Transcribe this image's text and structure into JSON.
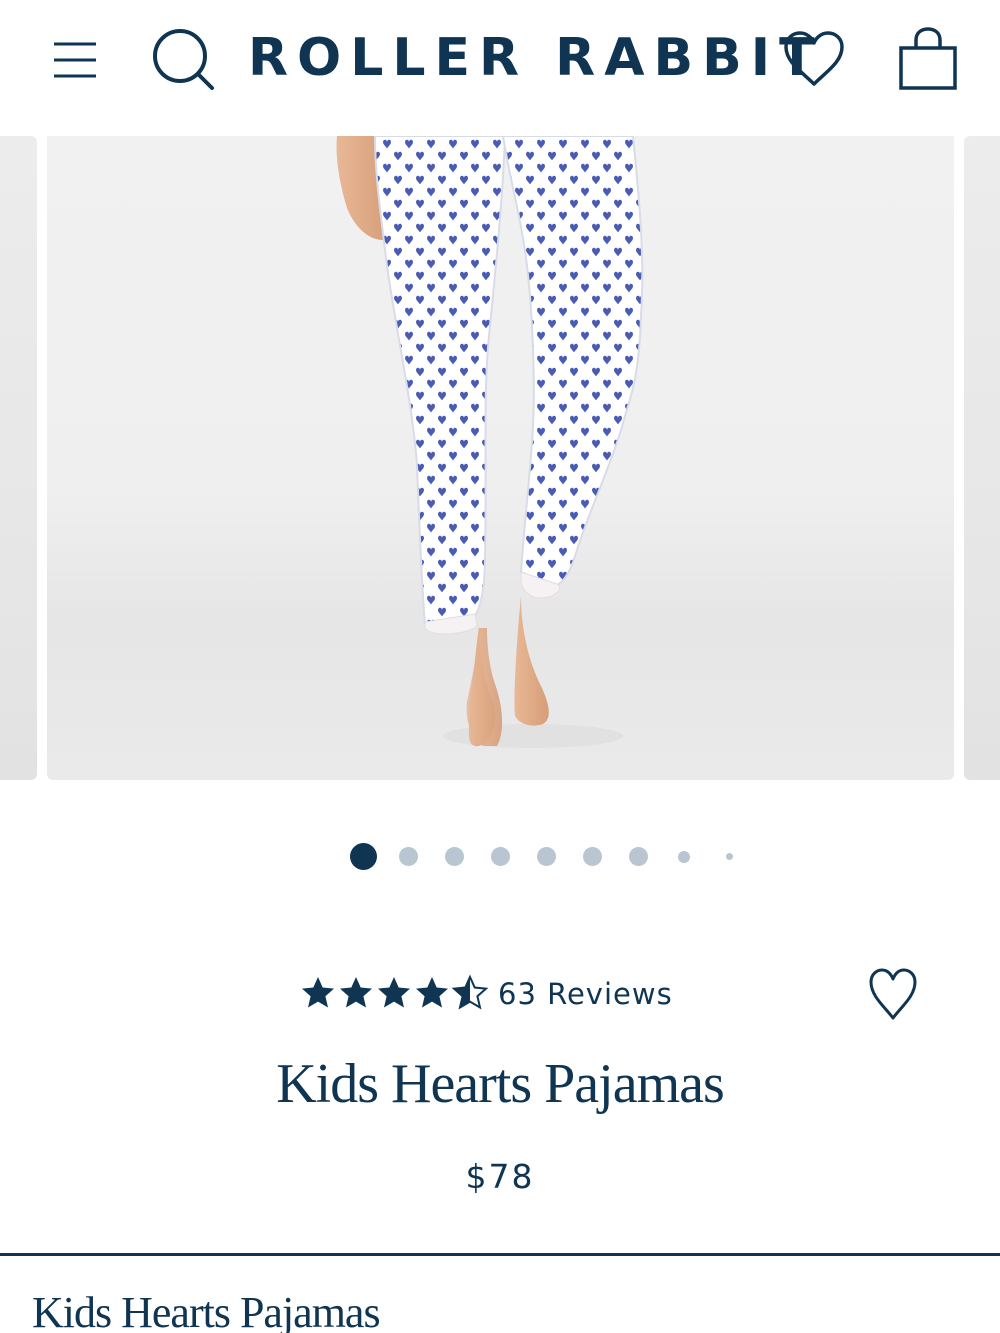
{
  "header": {
    "logo_text": "ROLLER RABBIT",
    "icons": [
      "menu-icon",
      "search-icon",
      "heart-icon",
      "shopping-bag-icon"
    ]
  },
  "carousel": {
    "current_slide": 1,
    "total_slides": 9,
    "image_subject": "hearts-print-pajama-pants"
  },
  "product": {
    "rating": 4.5,
    "rating_max": 5,
    "reviews_label": "63 Reviews",
    "title": "Kids Hearts Pajamas",
    "price": "$78"
  },
  "details": {
    "section_title": "Kids Hearts Pajamas"
  },
  "colors": {
    "navy": "#0f3552",
    "dot_inactive": "#b9c5d1",
    "print_blue": "#4a5bb5"
  }
}
